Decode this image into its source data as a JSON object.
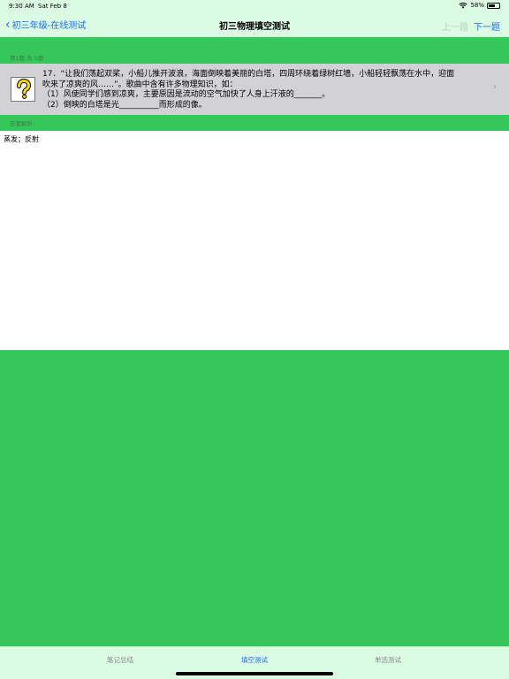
{
  "status_bar": {
    "time": "9:30 AM",
    "date": "Sat Feb 8",
    "battery": "58%"
  },
  "navbar": {
    "back_label": "初三年级-在线测试",
    "title": "初三物理填空测试",
    "prev_label": "上一题",
    "next_label": "下一题"
  },
  "question": {
    "counter": "第1题 共 5题",
    "lines": [
      "17．“让我们荡起双桨，小船儿推开波浪，海面倒映着美丽的白塔，四周环绕着绿树红墙，小船轻轻飘荡在水中，迎面",
      "吹来了凉爽的风……”。歌曲中含有许多物理知识，如：",
      "（1）风使同学们感到凉爽，主要原因是流动的空气加快了人身上汗液的_______。",
      "（2）倒映的白塔是光__________而形成的像。"
    ]
  },
  "answer": {
    "header": "答案解析：",
    "text": "蒸发；反射"
  },
  "tabs": [
    {
      "label": "笔记总结",
      "active": false
    },
    {
      "label": "填空测试",
      "active": true
    },
    {
      "label": "单选测试",
      "active": false
    }
  ],
  "colors": {
    "accent": "#1a6cff",
    "background_green": "#35c75a",
    "bar_bg": "#dbfbe3",
    "question_bg": "#d1d1d6"
  }
}
